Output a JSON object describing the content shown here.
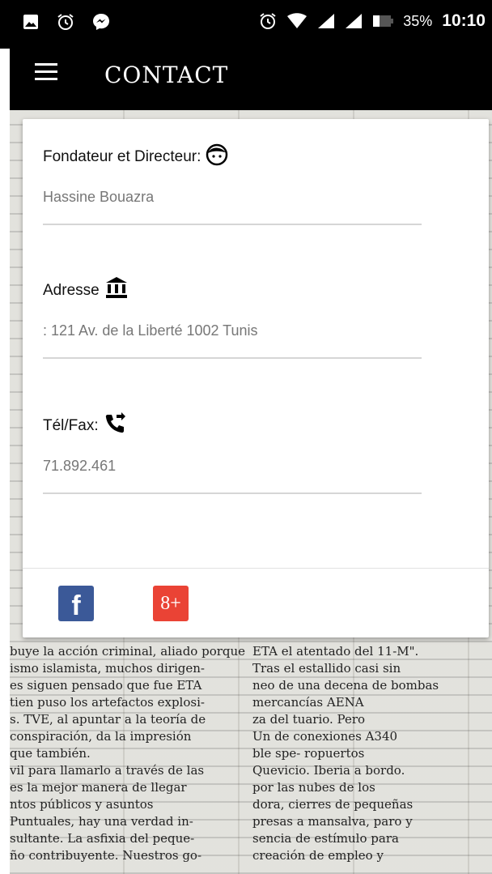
{
  "status_bar": {
    "battery": "35%",
    "time": "10:10",
    "icons": [
      "image-icon",
      "alarm-icon",
      "messenger-icon",
      "alarm-icon",
      "wifi-icon",
      "signal-icon",
      "signal-icon",
      "battery-icon"
    ]
  },
  "app_bar": {
    "title": "CONTACT",
    "menu_icon": "hamburger-icon"
  },
  "contact": {
    "founder_label": "Fondateur et Directeur:",
    "founder_icon": "face-icon",
    "founder_value": "Hassine Bouazra",
    "address_label": "Adresse",
    "address_icon": "bank-icon",
    "address_value": ": 121 Av. de la Liberté 1002 Tunis",
    "phone_label": "Tél/Fax:",
    "phone_icon": "phone-forwarded-icon",
    "phone_value": "71.892.461"
  },
  "social": {
    "facebook_glyph": "f",
    "googleplus_glyph": "8+"
  },
  "background_text": [
    "buye la acción criminal, aliado porque",
    "ismo islamista, muchos dirigen-",
    "es siguen pensado que fue ETA",
    "tien puso los artefactos explosi-",
    "s. TVE, al apuntar a la teoría de",
    "conspiración, da la impresión",
    "que también.",
    "vil para llamarlo a través de las",
    "es la mejor manera de llegar",
    "ntos públicos y asuntos",
    "Puntuales, hay una verdad in-",
    "sultante. La asfixia del peque-",
    "ño contribuyente. Nuestros go-"
  ],
  "background_text_right": [
    "ETA el atentado del 11-M\".",
    "Tras el estallido casi sin",
    "neo de una decena de bombas",
    "mercancías AENA",
    "za del tuario. Pero",
    "Un de conexiones A340",
    "ble spe- ropuertos",
    "Quevicio. Iberia a bordo.",
    "por las nubes de los",
    "dora, cierres de pequeñas",
    "presas a mansalva, paro y",
    "sencia de estímulo para",
    "creación de empleo y"
  ]
}
